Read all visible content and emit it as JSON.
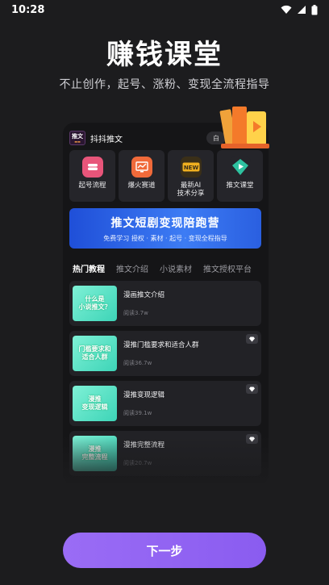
{
  "status_bar": {
    "time": "10:28"
  },
  "hero": {
    "title": "赚钱课堂",
    "subtitle": "不止创作，起号、涨粉、变现全流程指导"
  },
  "preview": {
    "app_name": "抖抖推文",
    "logo_text": "推文",
    "header_button": "白",
    "grid": [
      {
        "label": "起号流程",
        "icon": "start-icon",
        "color": "#e8557a"
      },
      {
        "label": "爆火赛道",
        "icon": "trend-chart-icon",
        "color": "#f06a3a"
      },
      {
        "label": "最新AI\n技术分享",
        "icon": "new-badge-icon",
        "color": "#f0b020"
      },
      {
        "label": "推文课堂",
        "icon": "play-diamond-icon",
        "color": "#2ec2a0"
      }
    ],
    "banner": {
      "title": "推文短剧变现陪跑营",
      "subtitle": "免费学习 授权 · 素材 · 起号 · 变现全程指导"
    },
    "tabs": [
      "热门教程",
      "推文介绍",
      "小说素材",
      "推文授权平台"
    ],
    "cards": [
      {
        "thumb": "什么是\n小说推文？",
        "title": "漫画推文介绍",
        "reads": "阅读3.7w",
        "vip": false
      },
      {
        "thumb": "门槛要求和\n适合人群",
        "title": "漫推门槛要求和适合人群",
        "reads": "阅读36.7w",
        "vip": true
      },
      {
        "thumb": "漫推\n变现逻辑",
        "title": "漫推变现逻辑",
        "reads": "阅读39.1w",
        "vip": true
      },
      {
        "thumb": "漫推\n完整流程",
        "title": "漫推完整流程",
        "reads": "阅读20.7w",
        "vip": true
      }
    ]
  },
  "next_button": "下一步",
  "colors": {
    "accent": "#9a6cf5",
    "background": "#1c1c1e",
    "banner": "#2a5fe0"
  }
}
